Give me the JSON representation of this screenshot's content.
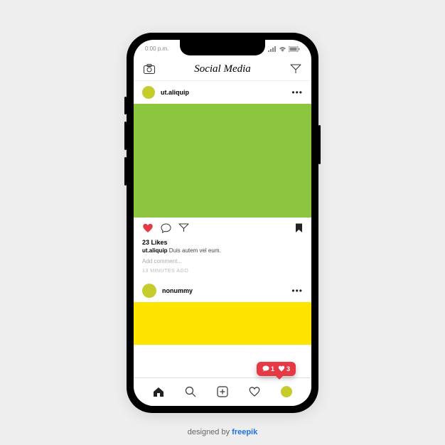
{
  "status": {
    "time": "0:00 p.m."
  },
  "header": {
    "title": "Social Media"
  },
  "post1": {
    "username": "ut.aliquip",
    "image_color": "#8cc63f",
    "likes": "23 Likes",
    "caption_user": "ut.aliquip",
    "caption_text": "Duis autem vel eum.",
    "comment_placeholder": "Add comment...",
    "timestamp": "13 MINUTES AGO"
  },
  "post2": {
    "username": "nonummy",
    "image_color": "#ffe400"
  },
  "notification": {
    "comments": "1",
    "likes": "3"
  },
  "footer": {
    "prefix": "designed by ",
    "brand": "freepik"
  }
}
